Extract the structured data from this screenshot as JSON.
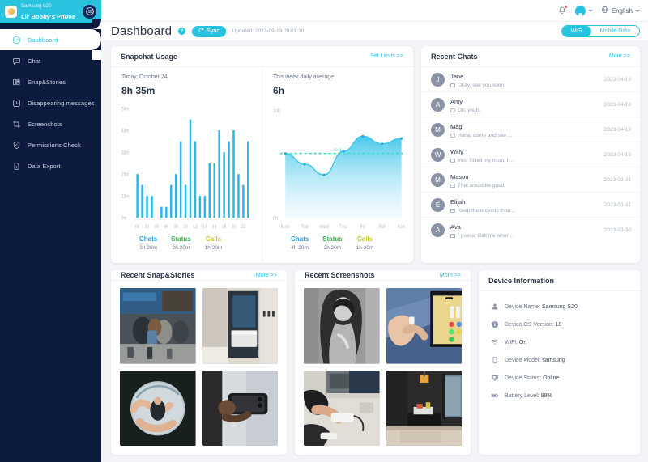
{
  "sidebar": {
    "device_model": "Samsung S20",
    "device_name": "Lil' Bobby's Phone",
    "switch_icon": "switch-device-icon",
    "items": [
      {
        "label": "Dashboard",
        "icon": "dashboard-icon",
        "active": true
      },
      {
        "label": "Chat",
        "icon": "chat-icon",
        "active": false
      },
      {
        "label": "Snap&Stories",
        "icon": "snap-stories-icon",
        "active": false
      },
      {
        "label": "Disappearing messages",
        "icon": "clock-icon",
        "active": false
      },
      {
        "label": "Screenshots",
        "icon": "screenshot-icon",
        "active": false
      },
      {
        "label": "Permissions Check",
        "icon": "shield-icon",
        "active": false
      },
      {
        "label": "Data Export",
        "icon": "export-icon",
        "active": false
      }
    ]
  },
  "topbar": {
    "bell_icon": "bell-icon",
    "avatar_icon": "user-avatar-icon",
    "globe_icon": "globe-icon",
    "language": "English"
  },
  "pagebar": {
    "title": "Dashboard",
    "help_icon": "help-icon",
    "sync_label": "Sync",
    "sync_icon": "refresh-icon",
    "updated": "Updated: 2023-09-13 09:01:10",
    "network": {
      "options": [
        "WiFi",
        "Mobile Data"
      ],
      "selected": "WiFi"
    }
  },
  "usage": {
    "title": "Snapchat Usage",
    "set_limits": "Set Limits >>",
    "today": {
      "label": "Today, October 24",
      "value": "8h 35m",
      "stats": [
        {
          "key": "Chats",
          "value": "3h 20m",
          "color": "#2f9be0"
        },
        {
          "key": "Status",
          "value": "2h 20m",
          "color": "#37b24d"
        },
        {
          "key": "Calls",
          "value": "1h 20m",
          "color": "#c2c827"
        }
      ]
    },
    "week": {
      "label": "This week daily average",
      "value": "6h",
      "stats": [
        {
          "key": "Chats",
          "value": "4h 20m",
          "color": "#2f9be0"
        },
        {
          "key": "Status",
          "value": "2h 20m",
          "color": "#37b24d"
        },
        {
          "key": "Calls",
          "value": "1h 20m",
          "color": "#c2c827"
        }
      ]
    }
  },
  "chart_data": [
    {
      "type": "bar",
      "title": "Today, October 24",
      "xlabel": "",
      "ylabel": "",
      "ylim": [
        0,
        50
      ],
      "yticks": [
        "0m",
        "10m",
        "20m",
        "30m",
        "40m",
        "50m"
      ],
      "categories": [
        "00",
        "01",
        "02",
        "03",
        "04",
        "05",
        "06",
        "07",
        "08",
        "09",
        "10",
        "11",
        "12",
        "13",
        "14",
        "15",
        "16",
        "17",
        "18",
        "19",
        "20",
        "21",
        "22",
        "23"
      ],
      "tick_labels": [
        "00",
        "02",
        "04",
        "06",
        "08",
        "10",
        "12",
        "14",
        "16",
        "18",
        "20",
        "22"
      ],
      "values": [
        20,
        15,
        10,
        10,
        0,
        5,
        5,
        15,
        20,
        35,
        15,
        45,
        35,
        10,
        10,
        25,
        25,
        40,
        30,
        35,
        40,
        20,
        15,
        35
      ],
      "color": "#29b6e8",
      "grid": false
    },
    {
      "type": "area",
      "title": "This week daily average",
      "xlabel": "",
      "ylabel": "",
      "ylim": [
        0,
        10
      ],
      "yticks": [
        "0h",
        "10h"
      ],
      "categories": [
        "Mon",
        "Tue",
        "Wed",
        "Thu",
        "Fri",
        "Sat",
        "Sun"
      ],
      "values": [
        6.0,
        5.0,
        4.0,
        6.2,
        7.6,
        6.9,
        7.4
      ],
      "avg_line": {
        "label": "Avg",
        "value": 6.0,
        "color": "#3ddccb"
      },
      "color": "#3fc6ea",
      "grid": false
    }
  ],
  "chats": {
    "title": "Recent Chats",
    "more": "More >>",
    "items": [
      {
        "initial": "J",
        "name": "Jane",
        "message": "Okay, see you soon.",
        "date": "2023-04-19"
      },
      {
        "initial": "A",
        "name": "Amy",
        "message": "Oh, yeah.",
        "date": "2023-04-19"
      },
      {
        "initial": "M",
        "name": "Mag",
        "message": "Haha, come and see ...",
        "date": "2023-04-19"
      },
      {
        "initial": "W",
        "name": "Willy",
        "message": "Yes! I'll tell my mum, I'...",
        "date": "2023-04-16"
      },
      {
        "initial": "M",
        "name": "Mason",
        "message": "That would be great!",
        "date": "2023-03-31"
      },
      {
        "initial": "E",
        "name": "Elijah",
        "message": "Keep the receipts thou...",
        "date": "2023-03-31"
      },
      {
        "initial": "A",
        "name": "Ava",
        "message": "I guess. Call me when...",
        "date": "2023-03-30"
      }
    ]
  },
  "snaps": {
    "title": "Recent Snap&Stories",
    "more": "More >>",
    "thumbs": [
      "street-crowd-photo",
      "hotel-room-doorway-photo",
      "hands-holding-sphere-photo",
      "hand-holding-phone-photo"
    ]
  },
  "screenshots": {
    "title": "Recent Screenshots",
    "more": "More >>",
    "thumbs": [
      "bw-portrait-screenshot",
      "phone-home-screen-screenshot",
      "hands-device-desk-screenshot",
      "dark-living-room-screenshot"
    ]
  },
  "device": {
    "title": "Device Information",
    "rows": [
      {
        "icon": "person-icon",
        "label": "Device Name: ",
        "value": "Samsung S20"
      },
      {
        "icon": "info-icon",
        "label": "Device OS Version: ",
        "value": "10"
      },
      {
        "icon": "wifi-icon",
        "label": "WiFi: ",
        "value": "On"
      },
      {
        "icon": "phone-icon",
        "label": "Device Model: ",
        "value": "samsung"
      },
      {
        "icon": "monitor-icon",
        "label": "Device Status: ",
        "value": "Online"
      },
      {
        "icon": "battery-icon",
        "label": "Battery Level: ",
        "value": "98%"
      }
    ]
  }
}
